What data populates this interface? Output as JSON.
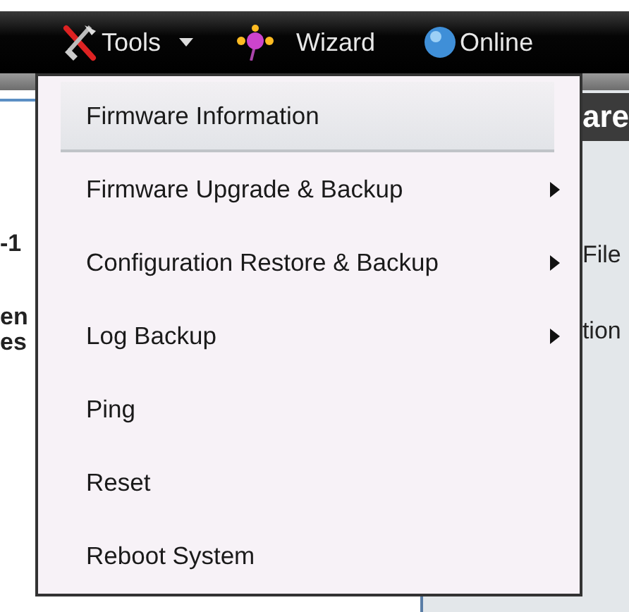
{
  "toolbar": {
    "items": [
      {
        "kind": "tools",
        "label": "Tools",
        "expanded": true
      },
      {
        "kind": "wizard",
        "label": "Wizard"
      },
      {
        "kind": "help",
        "label": "Online"
      }
    ]
  },
  "background": {
    "left_fragments": [
      "-1",
      "en",
      "es"
    ],
    "right_header": "are",
    "right_fragments": [
      "File",
      "tion"
    ]
  },
  "menu": {
    "items": [
      {
        "label": "Firmware Information",
        "selected": true,
        "submenu": false
      },
      {
        "label": "Firmware Upgrade & Backup",
        "selected": false,
        "submenu": true
      },
      {
        "label": "Configuration Restore & Backup",
        "selected": false,
        "submenu": true
      },
      {
        "label": "Log Backup",
        "selected": false,
        "submenu": true
      },
      {
        "label": "Ping",
        "selected": false,
        "submenu": false
      },
      {
        "label": "Reset",
        "selected": false,
        "submenu": false
      },
      {
        "label": "Reboot System",
        "selected": false,
        "submenu": false
      }
    ]
  }
}
